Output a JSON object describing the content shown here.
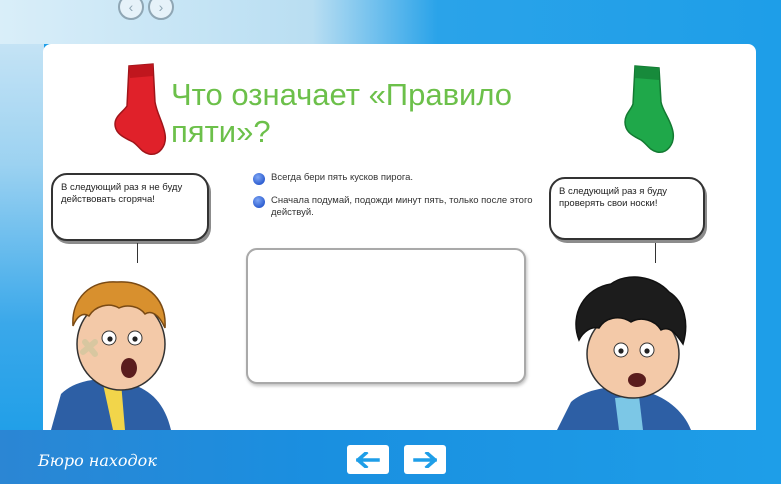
{
  "header": {
    "nav_icons": [
      "back-circle-icon",
      "forward-circle-icon"
    ]
  },
  "slide": {
    "title": "Что означает «Правило пяти»?",
    "left_bubble": "В следующий раз я не буду действовать сгоряча!",
    "right_bubble": "В следующий раз я буду проверять свои носки!",
    "options": [
      "Всегда бери пять кусков пирога.",
      "Сначала подумай, подожди минут пять, только после этого действуй."
    ],
    "answer_box_value": ""
  },
  "footer": {
    "bureau_label": "Бюро находок",
    "prev_icon": "arrow-left-icon",
    "next_icon": "arrow-right-icon"
  },
  "colors": {
    "background_blue": "#1e9ee8",
    "title_green": "#6cc04a",
    "radio_blue": "#2f5fd1",
    "sock_red": "#e0212a",
    "sock_green": "#1fa84a"
  }
}
